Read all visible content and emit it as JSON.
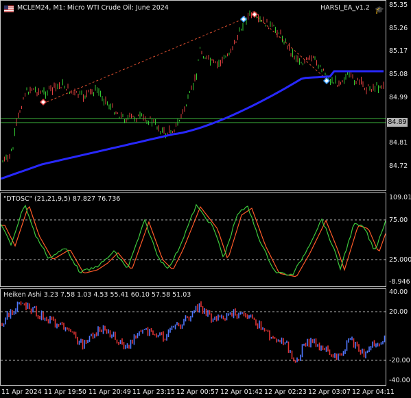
{
  "header": {
    "symbol_info": "MCLEM24, M1:  Micro WTI Crude Oil: June 2024",
    "ea_name": "HARSI_EA_v1.2"
  },
  "main_axis": {
    "labels": [
      "85.35",
      "85.26",
      "85.17",
      "85.08",
      "84.99",
      "84.81",
      "84.72"
    ],
    "current_price": "84.89"
  },
  "dtosc": {
    "title": "\"DTOSC\" (21,21,9,5) 87.827 76.736",
    "labels": [
      "109.01",
      "75.00",
      "25.000",
      "-8.946"
    ]
  },
  "heiken": {
    "title": "Heiken Ashi 3.23 7.58 1.03 4.53 55.41 60.10 57.58 51.03",
    "labels": [
      "40.00",
      "20.00",
      "-20.00",
      "-40.00"
    ]
  },
  "time_axis": {
    "labels": [
      "11 Apr 2024",
      "11 Apr 19:50",
      "11 Apr 20:49",
      "11 Apr 23:15",
      "12 Apr 00:57",
      "12 Apr 01:42",
      "12 Apr 02:23",
      "12 Apr 03:07",
      "12 Apr 04:11"
    ]
  },
  "colors": {
    "bull": "#32c832",
    "bear": "#e04040",
    "ma": "#2828ff",
    "hline": "#3cb43c",
    "osc_fast": "#3cc83c",
    "osc_slow": "#ff5a28",
    "ha_up": "#5078ff",
    "ha_down": "#e03232"
  }
}
